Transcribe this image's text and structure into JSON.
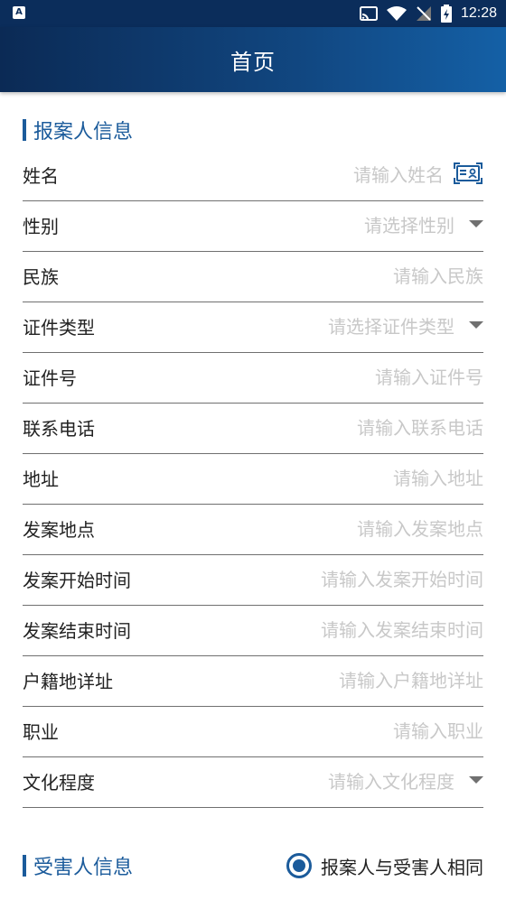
{
  "status_bar": {
    "left_icon_letter": "A",
    "time": "12:28"
  },
  "app_bar": {
    "title": "首页"
  },
  "reporter_section": {
    "title": "报案人信息",
    "fields": [
      {
        "label": "姓名",
        "placeholder": "请输入姓名",
        "kind": "input-idcard"
      },
      {
        "label": "性别",
        "placeholder": "请选择性别",
        "kind": "select"
      },
      {
        "label": "民族",
        "placeholder": "请输入民族",
        "kind": "input"
      },
      {
        "label": "证件类型",
        "placeholder": "请选择证件类型",
        "kind": "select"
      },
      {
        "label": "证件号",
        "placeholder": "请输入证件号",
        "kind": "input"
      },
      {
        "label": "联系电话",
        "placeholder": "请输入联系电话",
        "kind": "input"
      },
      {
        "label": "地址",
        "placeholder": "请输入地址",
        "kind": "input"
      },
      {
        "label": "发案地点",
        "placeholder": "请输入发案地点",
        "kind": "input"
      },
      {
        "label": "发案开始时间",
        "placeholder": "请输入发案开始时间",
        "kind": "input"
      },
      {
        "label": "发案结束时间",
        "placeholder": "请输入发案结束时间",
        "kind": "input"
      },
      {
        "label": "户籍地详址",
        "placeholder": "请输入户籍地详址",
        "kind": "input"
      },
      {
        "label": "职业",
        "placeholder": "请输入职业",
        "kind": "input"
      },
      {
        "label": "文化程度",
        "placeholder": "请输入文化程度",
        "kind": "select"
      }
    ]
  },
  "victim_section": {
    "title": "受害人信息",
    "same_as_reporter_label": "报案人与受害人相同",
    "same_as_reporter_checked": true
  },
  "colors": {
    "accent": "#1b5b9b",
    "appbar_start": "#0b2a55",
    "appbar_end": "#1460a6",
    "placeholder": "#c8c8c8",
    "divider": "#707070"
  }
}
